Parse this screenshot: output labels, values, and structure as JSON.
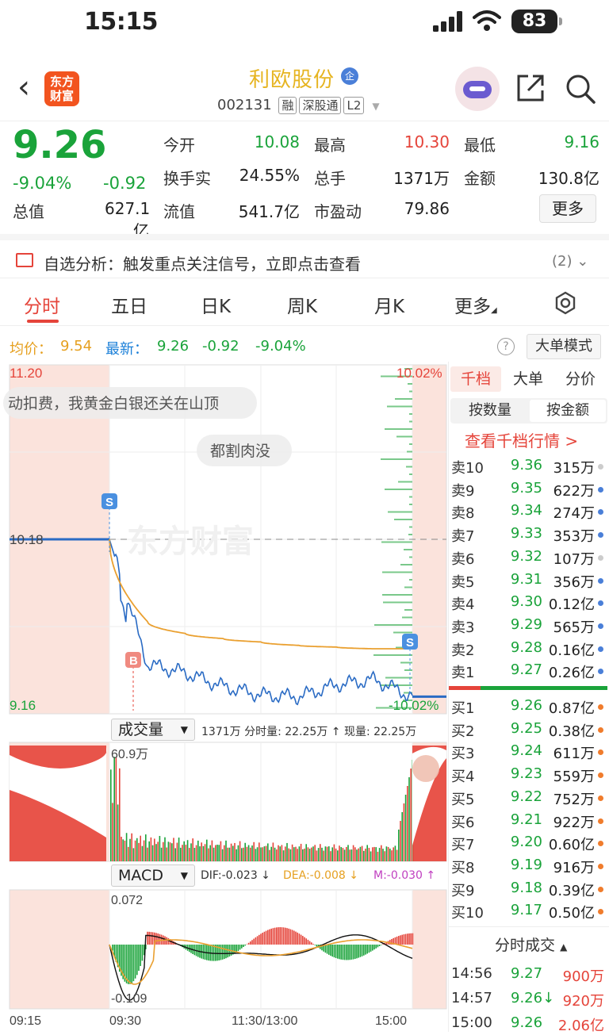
{
  "status": {
    "time": "15:15",
    "battery": "83"
  },
  "nav": {
    "back": "‹",
    "logo_line1": "东方",
    "logo_line2": "财富",
    "stock_name": "利欧股份",
    "qi_badge": "企",
    "code": "002131",
    "tags": [
      "融",
      "深股通",
      "L2"
    ]
  },
  "quote": {
    "price": "9.26",
    "pct": "-9.04%",
    "change": "-0.92",
    "cells": [
      {
        "label": "今开",
        "value": "10.08",
        "color": "#1aa33a"
      },
      {
        "label": "最高",
        "value": "10.30",
        "color": "#e5443a"
      },
      {
        "label": "最低",
        "value": "9.16",
        "color": "#1aa33a"
      },
      {
        "label": "换手实",
        "value": "24.55%",
        "color": "#222"
      },
      {
        "label": "总手",
        "value": "1371万",
        "color": "#222"
      },
      {
        "label": "金额",
        "value": "130.8亿",
        "color": "#222"
      },
      {
        "label": "总值",
        "value": "627.1亿",
        "color": "#222"
      },
      {
        "label": "流值",
        "value": "541.7亿",
        "color": "#222"
      },
      {
        "label": "市盈动",
        "value": "79.86",
        "color": "#222"
      }
    ],
    "more_label": "更多"
  },
  "analysis": {
    "text": "自选分析：触发重点关注信号，立即点击查看",
    "count": "(2)"
  },
  "tabs": [
    "分时",
    "五日",
    "日K",
    "周K",
    "月K",
    "更多"
  ],
  "avg_line": {
    "avg_label": "均价：",
    "avg": "9.54",
    "latest_label": "最新：",
    "latest": "9.26",
    "change": "-0.92",
    "pct": "-9.04%",
    "mode_label": "大单模式"
  },
  "chart": {
    "y_top": "11.20",
    "y_bottom": "9.16",
    "pct_top": "10.02%",
    "pct_bottom": "-10.02%",
    "prev_close": "10.18",
    "danmaku1": "动扣费，我黄金白银还关在山顶",
    "danmaku2": "都割肉没",
    "watermark": "东方财富",
    "vol_selector": "成交量",
    "vol_info": "1371万 分时量: 22.25万 ↑ 现量: 22.25万",
    "vol_max": "60.9万",
    "macd_selector": "MACD",
    "dif": "DIF:-0.023 ↓",
    "dea": "DEA:-0.008 ↓",
    "m": "M:-0.030 ↑",
    "macd_top": "0.072",
    "macd_bottom": "-0.109",
    "x_labels": [
      "09:15",
      "09:30",
      "11:30/13:00",
      "15:00"
    ],
    "marker_s": "S",
    "marker_b": "B"
  },
  "chart_data": {
    "type": "line",
    "title": "",
    "x": [
      "09:30",
      "10:00",
      "10:30",
      "11:00",
      "11:30",
      "13:30",
      "14:00",
      "14:30",
      "15:00"
    ],
    "series": [
      {
        "name": "最新",
        "values": [
          10.18,
          9.45,
          9.4,
          9.32,
          9.27,
          9.26,
          9.33,
          9.36,
          9.26
        ]
      },
      {
        "name": "均价",
        "values": [
          10.18,
          9.7,
          9.63,
          9.6,
          9.58,
          9.56,
          9.55,
          9.54,
          9.54
        ]
      }
    ],
    "ylim": [
      9.16,
      11.2
    ]
  },
  "orderbook": {
    "tabs": [
      "千档",
      "大单",
      "分价"
    ],
    "subtabs": [
      "按数量",
      "按金额"
    ],
    "view_all": "查看千档行情 >",
    "asks": [
      {
        "label": "卖10",
        "price": "9.36",
        "vol": "315万",
        "dot": "#ccc"
      },
      {
        "label": "卖9",
        "price": "9.35",
        "vol": "622万",
        "dot": "#4a7fd8"
      },
      {
        "label": "卖8",
        "price": "9.34",
        "vol": "274万",
        "dot": "#4a7fd8"
      },
      {
        "label": "卖7",
        "price": "9.33",
        "vol": "353万",
        "dot": "#4a7fd8"
      },
      {
        "label": "卖6",
        "price": "9.32",
        "vol": "107万",
        "dot": "#ccc"
      },
      {
        "label": "卖5",
        "price": "9.31",
        "vol": "356万",
        "dot": "#4a7fd8"
      },
      {
        "label": "卖4",
        "price": "9.30",
        "vol": "0.12亿",
        "dot": "#4a7fd8"
      },
      {
        "label": "卖3",
        "price": "9.29",
        "vol": "565万",
        "dot": "#4a7fd8"
      },
      {
        "label": "卖2",
        "price": "9.28",
        "vol": "0.16亿",
        "dot": "#4a7fd8"
      },
      {
        "label": "卖1",
        "price": "9.27",
        "vol": "0.26亿",
        "dot": "#4a7fd8"
      }
    ],
    "bids": [
      {
        "label": "买1",
        "price": "9.26",
        "vol": "0.87亿",
        "dot": "#f07c2c"
      },
      {
        "label": "买2",
        "price": "9.25",
        "vol": "0.38亿",
        "dot": "#f07c2c"
      },
      {
        "label": "买3",
        "price": "9.24",
        "vol": "611万",
        "dot": "#f07c2c"
      },
      {
        "label": "买4",
        "price": "9.23",
        "vol": "559万",
        "dot": "#f07c2c"
      },
      {
        "label": "买5",
        "price": "9.22",
        "vol": "752万",
        "dot": "#f07c2c"
      },
      {
        "label": "买6",
        "price": "9.21",
        "vol": "922万",
        "dot": "#f07c2c"
      },
      {
        "label": "买7",
        "price": "9.20",
        "vol": "0.60亿",
        "dot": "#f07c2c"
      },
      {
        "label": "买8",
        "price": "9.19",
        "vol": "916万",
        "dot": "#f07c2c"
      },
      {
        "label": "买9",
        "price": "9.18",
        "vol": "0.39亿",
        "dot": "#f07c2c"
      },
      {
        "label": "买10",
        "price": "9.17",
        "vol": "0.50亿",
        "dot": "#f07c2c"
      }
    ],
    "trades_title": "分时成交",
    "trades": [
      {
        "time": "14:56",
        "price": "9.27",
        "vol": "900万"
      },
      {
        "time": "14:57",
        "price": "9.26↓",
        "vol": "920万"
      },
      {
        "time": "15:00",
        "price": "9.26",
        "vol": "2.06亿"
      }
    ]
  }
}
